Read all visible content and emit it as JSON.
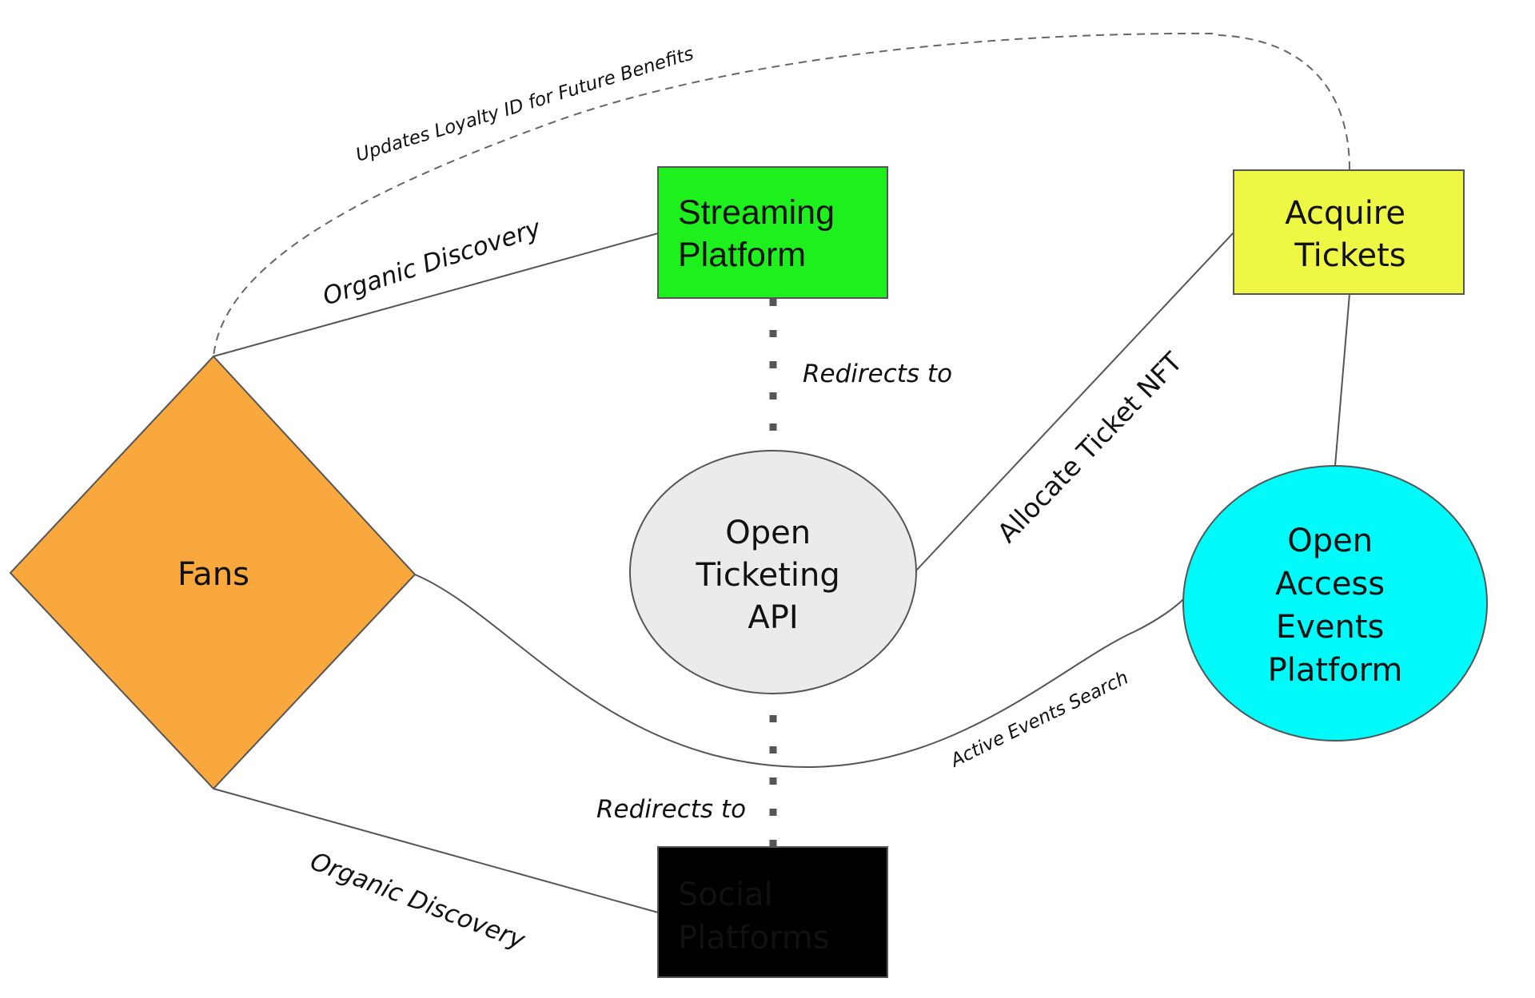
{
  "diagram": {
    "type": "flow-diagram",
    "nodes": {
      "fans": {
        "label": "Fans",
        "shape": "diamond",
        "fill": "#F9A83D",
        "text_color": "#111111"
      },
      "streaming": {
        "label_lines": [
          "Streaming",
          "Platform"
        ],
        "shape": "rectangle",
        "fill": "#1EF01E",
        "text_color": "#111111"
      },
      "acquire": {
        "label_lines": [
          "Acquire",
          "Tickets"
        ],
        "shape": "rectangle",
        "fill": "#EDF744",
        "text_color": "#111111"
      },
      "api": {
        "label_lines": [
          "Open",
          "Ticketing",
          "API"
        ],
        "shape": "ellipse",
        "fill": "#EBEBEB",
        "text_color": "#111111"
      },
      "events": {
        "label_lines": [
          "Open",
          "Access",
          "Events",
          "Platform"
        ],
        "shape": "ellipse",
        "fill": "#00FAFA",
        "text_color": "#111111"
      },
      "social": {
        "label_lines": [
          "Social",
          "Platforms"
        ],
        "shape": "rectangle",
        "fill": "#000000",
        "text_color": "#FF33FF"
      }
    },
    "edges": [
      {
        "id": "fans-streaming",
        "from": "Fans",
        "to": "Streaming Platform",
        "style": "solid",
        "label": "Organic Discovery"
      },
      {
        "id": "fans-social",
        "from": "Fans",
        "to": "Social Platforms",
        "style": "solid",
        "label": "Organic Discovery"
      },
      {
        "id": "fans-events",
        "from": "Fans",
        "to": "Open Access Events Platform",
        "style": "solid-curve",
        "label": "Active Events Search"
      },
      {
        "id": "streaming-api",
        "from": "Streaming Platform",
        "to": "Open Ticketing API",
        "style": "dotted",
        "label": "Redirects to"
      },
      {
        "id": "social-api",
        "from": "Social Platforms",
        "to": "Open Ticketing API",
        "style": "dotted",
        "label": "Redirects to"
      },
      {
        "id": "api-acquire",
        "from": "Open Ticketing API",
        "to": "Acquire Tickets",
        "style": "solid",
        "label": "Allocate Ticket NFT"
      },
      {
        "id": "acquire-events",
        "from": "Acquire Tickets",
        "to": "Open Access Events Platform",
        "style": "solid",
        "label": ""
      },
      {
        "id": "acquire-fans",
        "from": "Acquire Tickets",
        "to": "Fans",
        "style": "dashed-curve",
        "label": "Updates Loyalty ID for Future Benefits"
      }
    ],
    "colors": {
      "edge": "#555555",
      "shape_border": "#555555",
      "background": "#FFFFFF"
    }
  }
}
